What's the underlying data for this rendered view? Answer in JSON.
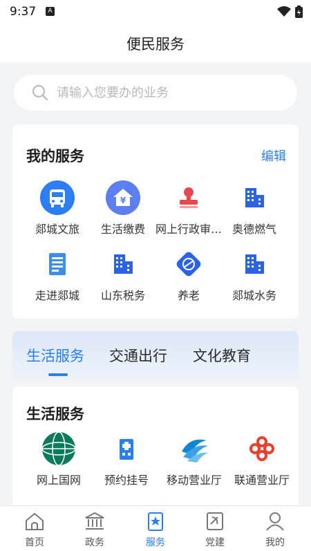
{
  "status": {
    "time": "9:37",
    "notif": "A"
  },
  "header": {
    "title": "便民服务"
  },
  "search": {
    "placeholder": "请输入您要办的业务"
  },
  "my_services": {
    "title": "我的服务",
    "edit_label": "编辑",
    "items": [
      {
        "label": "郯城文旅",
        "icon": "bus-icon"
      },
      {
        "label": "生活缴费",
        "icon": "payment-house-icon"
      },
      {
        "label": "网上行政审…",
        "icon": "stamp-icon"
      },
      {
        "label": "奥德燃气",
        "icon": "building-icon"
      },
      {
        "label": "走进郯城",
        "icon": "document-icon"
      },
      {
        "label": "山东税务",
        "icon": "building-icon"
      },
      {
        "label": "养老",
        "icon": "pension-icon"
      },
      {
        "label": "郯城水务",
        "icon": "building-icon"
      }
    ]
  },
  "tabs": [
    {
      "label": "生活服务",
      "active": true
    },
    {
      "label": "交通出行",
      "active": false
    },
    {
      "label": "文化教育",
      "active": false
    }
  ],
  "life_services": {
    "title": "生活服务",
    "items": [
      {
        "label": "网上国网",
        "icon": "state-grid-icon"
      },
      {
        "label": "预约挂号",
        "icon": "hospital-icon"
      },
      {
        "label": "移动营业厅",
        "icon": "china-mobile-icon"
      },
      {
        "label": "联通营业厅",
        "icon": "china-unicom-icon"
      }
    ]
  },
  "bottom_nav": [
    {
      "label": "首页",
      "icon": "home-icon"
    },
    {
      "label": "政务",
      "icon": "government-icon"
    },
    {
      "label": "服务",
      "icon": "service-icon",
      "active": true
    },
    {
      "label": "党建",
      "icon": "party-icon"
    },
    {
      "label": "我的",
      "icon": "profile-icon"
    }
  ],
  "colors": {
    "accent": "#2a7ef2",
    "background": "#f2f3f5"
  }
}
